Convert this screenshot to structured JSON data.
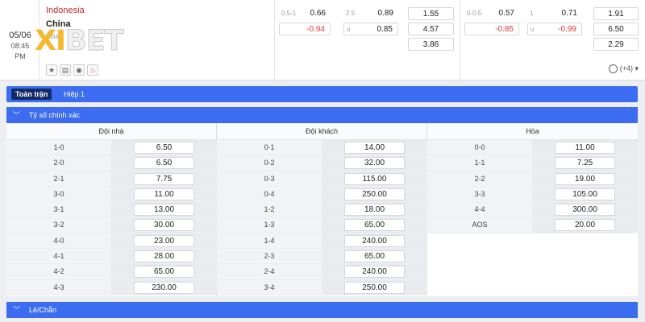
{
  "match": {
    "date": "05/06",
    "time": "08:45 PM",
    "home": "Indonesia",
    "away": "China",
    "extra": "Hòa"
  },
  "logo": {
    "x": "XI",
    "bet": "BET"
  },
  "icons": [
    "star-icon",
    "stats-icon",
    "eye-icon",
    "fire-icon"
  ],
  "odds": {
    "h1": [
      {
        "label": "0.5-1",
        "value": "0.66",
        "red": false
      },
      {
        "label": "",
        "value": "-0.94",
        "red": true
      }
    ],
    "ou1": [
      {
        "label": "2.5",
        "value": "0.89",
        "red": false
      },
      {
        "label": "u",
        "value": "0.85",
        "red": false
      }
    ],
    "x12a": [
      "1.55",
      "4.57",
      "3.86"
    ],
    "h2": [
      {
        "label": "0-0.5",
        "value": "0.57",
        "red": false
      },
      {
        "label": "",
        "value": "-0.85",
        "red": true
      }
    ],
    "ou2": [
      {
        "label": "1",
        "value": "0.71",
        "red": false
      },
      {
        "label": "u",
        "value": "-0.99",
        "red": true
      }
    ],
    "x12b": [
      "1.91",
      "6.50",
      "2.29"
    ]
  },
  "more_markets": "(+4)",
  "tabs": [
    "Toàn trận",
    "Hiệp 1"
  ],
  "section_correct_score": "Tỷ số chính xác",
  "section_odd_even": "Lẻ/Chẵn",
  "columns": [
    {
      "header": "Đội nhà",
      "rows": [
        {
          "score": "1-0",
          "odd": "6.50"
        },
        {
          "score": "2-0",
          "odd": "6.50"
        },
        {
          "score": "2-1",
          "odd": "7.75"
        },
        {
          "score": "3-0",
          "odd": "11.00"
        },
        {
          "score": "3-1",
          "odd": "13.00"
        },
        {
          "score": "3-2",
          "odd": "30.00"
        },
        {
          "score": "4-0",
          "odd": "23.00"
        },
        {
          "score": "4-1",
          "odd": "28.00"
        },
        {
          "score": "4-2",
          "odd": "65.00"
        },
        {
          "score": "4-3",
          "odd": "230.00"
        }
      ]
    },
    {
      "header": "Đội khách",
      "rows": [
        {
          "score": "0-1",
          "odd": "14.00"
        },
        {
          "score": "0-2",
          "odd": "32.00"
        },
        {
          "score": "0-3",
          "odd": "115.00"
        },
        {
          "score": "0-4",
          "odd": "250.00"
        },
        {
          "score": "1-2",
          "odd": "18.00"
        },
        {
          "score": "1-3",
          "odd": "65.00"
        },
        {
          "score": "1-4",
          "odd": "240.00"
        },
        {
          "score": "2-3",
          "odd": "65.00"
        },
        {
          "score": "2-4",
          "odd": "240.00"
        },
        {
          "score": "3-4",
          "odd": "250.00"
        }
      ]
    },
    {
      "header": "Hòa",
      "rows": [
        {
          "score": "0-0",
          "odd": "11.00"
        },
        {
          "score": "1-1",
          "odd": "7.25"
        },
        {
          "score": "2-2",
          "odd": "19.00"
        },
        {
          "score": "3-3",
          "odd": "105.00"
        },
        {
          "score": "4-4",
          "odd": "300.00"
        },
        {
          "score": "AOS",
          "odd": "20.00"
        }
      ]
    }
  ]
}
